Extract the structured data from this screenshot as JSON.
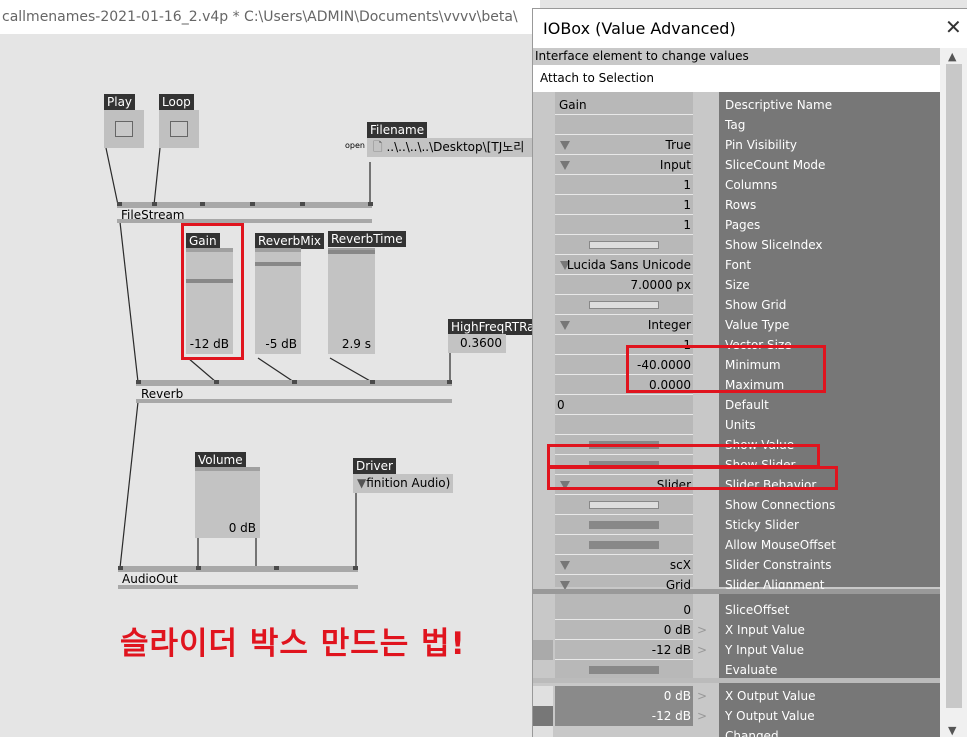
{
  "editor": {
    "title": "callmenames-2021-01-16_2.v4p *   C:\\Users\\ADMIN\\Documents\\vvvv\\beta\\",
    "nodes": {
      "play": "Play",
      "loop": "Loop",
      "filename": "Filename",
      "open": "open",
      "filename_value": "..\\..\\..\\..\\Desktop\\[TJ노리",
      "filestream": "FileStream",
      "gain": "Gain",
      "gain_value": "-12 dB",
      "reverbmix": "ReverbMix",
      "reverbmix_value": "-5 dB",
      "reverbtime": "ReverbTime",
      "reverbtime_value": "2.9 s",
      "highfreq": "HighFreqRTRa",
      "highfreq_value": "0.3600",
      "reverb": "Reverb",
      "volume": "Volume",
      "volume_value": "0 dB",
      "driver": "Driver",
      "driver_value": "finition Audio)",
      "audioout": "AudioOut"
    },
    "caption": "슬라이더 박스 만드는 법!"
  },
  "inspector": {
    "title": "IOBox (Value Advanced)",
    "close": "✕",
    "description": "Interface element to change values",
    "attach": "Attach to Selection",
    "left_value": "0",
    "rows": [
      {
        "value": "Gain",
        "name": "Descriptive Name",
        "align": "left"
      },
      {
        "value": "",
        "name": "Tag"
      },
      {
        "value": "True",
        "name": "Pin Visibility",
        "dropdown": true
      },
      {
        "value": "Input",
        "name": "SliceCount Mode",
        "dropdown": true
      },
      {
        "value": "1",
        "name": "Columns"
      },
      {
        "value": "1",
        "name": "Rows"
      },
      {
        "value": "1",
        "name": "Pages"
      },
      {
        "value": "",
        "name": "Show SliceIndex",
        "bar": "empty"
      },
      {
        "value": "Lucida Sans Unicode",
        "name": "Font",
        "dropdown": true
      },
      {
        "value": "7.0000 px",
        "name": "Size"
      },
      {
        "value": "",
        "name": "Show Grid",
        "bar": "empty"
      },
      {
        "value": "Integer",
        "name": "Value Type",
        "dropdown": true
      },
      {
        "value": "1",
        "name": "Vector Size"
      },
      {
        "value": "-40.0000",
        "name": "Minimum"
      },
      {
        "value": "0.0000",
        "name": "Maximum"
      },
      {
        "value": "",
        "name": "Default"
      },
      {
        "value": "",
        "name": "Units"
      },
      {
        "value": "",
        "name": "Show Value",
        "bar": "filled"
      },
      {
        "value": "",
        "name": "Show Slider",
        "bar": "filled"
      },
      {
        "value": "Slider",
        "name": "Slider Behavior",
        "dropdown": true
      },
      {
        "value": "",
        "name": "Show Connections",
        "bar": "empty"
      },
      {
        "value": "",
        "name": "Sticky Slider",
        "bar": "filled"
      },
      {
        "value": "",
        "name": "Allow MouseOffset",
        "bar": "filled"
      },
      {
        "value": "scX",
        "name": "Slider Constraints",
        "dropdown": true
      },
      {
        "value": "Grid",
        "name": "Slider Alignment",
        "dropdown": true
      }
    ],
    "pins": [
      {
        "value": "0",
        "name": "SliceOffset"
      },
      {
        "value": "0 dB",
        "name": "X Input Value",
        "arrow": ">"
      },
      {
        "value": "-12 dB",
        "name": "Y Input Value",
        "arrow": ">"
      },
      {
        "value": "",
        "name": "Evaluate",
        "bar": "filled"
      }
    ],
    "outputs": [
      {
        "value": "0 dB",
        "name": "X Output Value",
        "arrow": ">"
      },
      {
        "value": "-12 dB",
        "name": "Y Output Value",
        "arrow": ">"
      },
      {
        "value": "",
        "name": "Changed"
      }
    ]
  },
  "colors": {
    "highlight": "#e0141e",
    "node_label_bg": "#333333"
  }
}
